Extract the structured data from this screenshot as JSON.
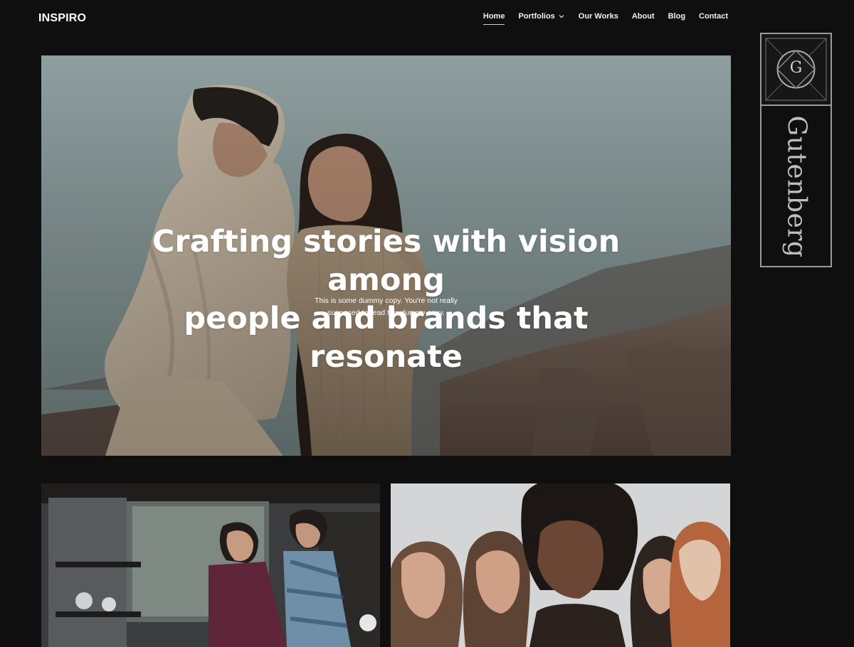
{
  "site": {
    "logo": "INSPIRO"
  },
  "nav": {
    "items": [
      {
        "label": "Home",
        "active": true
      },
      {
        "label": "Portfolios",
        "has_dropdown": true
      },
      {
        "label": "Our Works"
      },
      {
        "label": "About"
      },
      {
        "label": "Blog"
      },
      {
        "label": "Contact"
      }
    ]
  },
  "hero": {
    "title": "Crafting stories with vision among\npeople and brands that resonate",
    "subtitle": "This is some dummy copy. You're not really\nsupposed to read this dummy copy."
  },
  "badge": {
    "label": "Gutenberg",
    "icon": "gutenberg-g-icon"
  },
  "colors": {
    "background": "#0f0f10",
    "text": "#ffffff",
    "badge_stroke": "#9a9a9a"
  }
}
